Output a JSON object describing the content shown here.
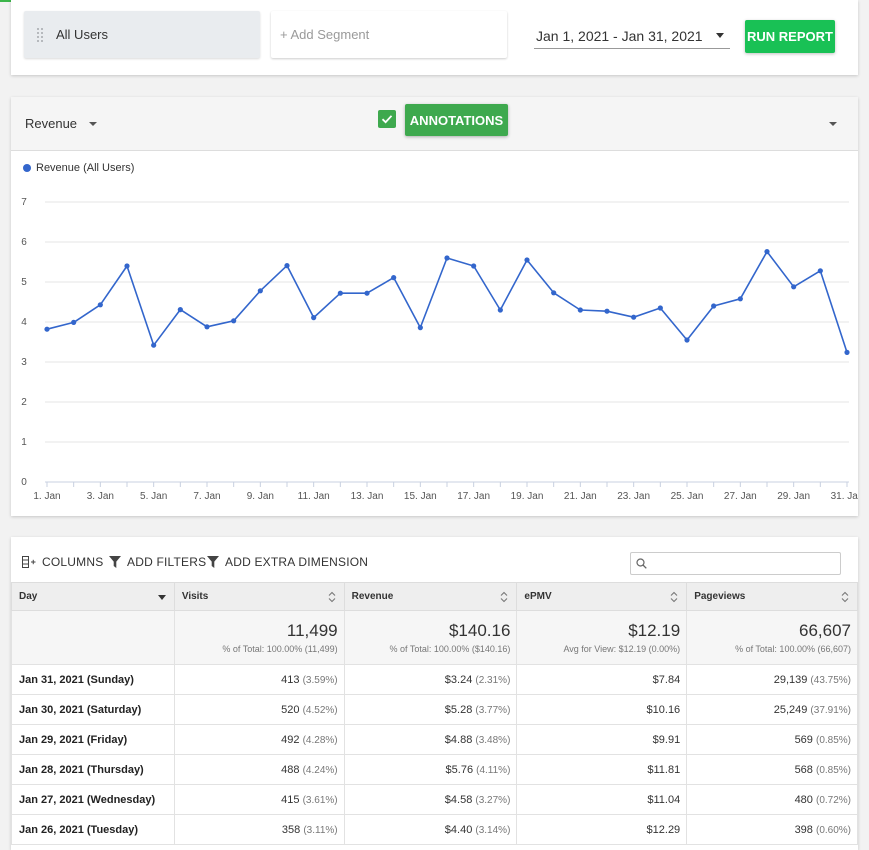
{
  "filters": {
    "segment_label": "All Users",
    "add_segment_label": "+ Add Segment",
    "date_range": "Jan 1, 2021 - Jan 31, 2021",
    "run_report_label": "RUN REPORT"
  },
  "chart_toolbar": {
    "metric": "Revenue",
    "annotations_label": "ANNOTATIONS"
  },
  "chart_data": {
    "type": "line",
    "x": [
      "1. Jan",
      "2. Jan",
      "3. Jan",
      "4. Jan",
      "5. Jan",
      "6. Jan",
      "7. Jan",
      "8. Jan",
      "9. Jan",
      "10. Jan",
      "11. Jan",
      "12. Jan",
      "13. Jan",
      "14. Jan",
      "15. Jan",
      "16. Jan",
      "17. Jan",
      "18. Jan",
      "19. Jan",
      "20. Jan",
      "21. Jan",
      "22. Jan",
      "23. Jan",
      "24. Jan",
      "25. Jan",
      "26. Jan",
      "27. Jan",
      "28. Jan",
      "29. Jan",
      "30. Jan",
      "31. Jan"
    ],
    "tick_labels": [
      "1. Jan",
      "3. Jan",
      "5. Jan",
      "7. Jan",
      "9. Jan",
      "11. Jan",
      "13. Jan",
      "15. Jan",
      "17. Jan",
      "19. Jan",
      "21. Jan",
      "23. Jan",
      "25. Jan",
      "27. Jan",
      "29. Jan",
      "31. Jan"
    ],
    "series": [
      {
        "name": "Revenue (All Users)",
        "color": "#3366cc",
        "values": [
          3.82,
          3.99,
          4.43,
          5.4,
          3.42,
          4.31,
          3.88,
          4.03,
          4.78,
          5.41,
          4.11,
          4.72,
          4.72,
          5.11,
          3.86,
          5.6,
          5.4,
          4.3,
          5.55,
          4.73,
          4.3,
          4.27,
          4.12,
          4.35,
          3.55,
          4.4,
          4.58,
          5.76,
          4.88,
          5.28,
          3.24
        ]
      }
    ],
    "ylim": [
      0,
      7
    ],
    "yticks": [
      0,
      1,
      2,
      3,
      4,
      5,
      6,
      7
    ],
    "grid": true
  },
  "table_tools": {
    "columns_label": "COLUMNS",
    "filters_label": "ADD FILTERS",
    "dimension_label": "ADD EXTRA DIMENSION",
    "search_placeholder": ""
  },
  "table": {
    "headers": [
      "Day",
      "Visits",
      "Revenue",
      "ePMV",
      "Pageviews"
    ],
    "totals": [
      {
        "value": "11,499",
        "sub": "% of Total: 100.00% (11,499)"
      },
      {
        "value": "$140.16",
        "sub": "% of Total: 100.00% ($140.16)"
      },
      {
        "value": "$12.19",
        "sub": "Avg for View: $12.19 (0.00%)"
      },
      {
        "value": "66,607",
        "sub": "% of Total: 100.00% (66,607)"
      }
    ],
    "rows": [
      {
        "day": "Jan 31, 2021 (Sunday)",
        "visits": "413",
        "visits_pct": "(3.59%)",
        "revenue": "$3.24",
        "revenue_pct": "(2.31%)",
        "epmv": "$7.84",
        "pageviews": "29,139",
        "pageviews_pct": "(43.75%)"
      },
      {
        "day": "Jan 30, 2021 (Saturday)",
        "visits": "520",
        "visits_pct": "(4.52%)",
        "revenue": "$5.28",
        "revenue_pct": "(3.77%)",
        "epmv": "$10.16",
        "pageviews": "25,249",
        "pageviews_pct": "(37.91%)"
      },
      {
        "day": "Jan 29, 2021 (Friday)",
        "visits": "492",
        "visits_pct": "(4.28%)",
        "revenue": "$4.88",
        "revenue_pct": "(3.48%)",
        "epmv": "$9.91",
        "pageviews": "569",
        "pageviews_pct": "(0.85%)"
      },
      {
        "day": "Jan 28, 2021 (Thursday)",
        "visits": "488",
        "visits_pct": "(4.24%)",
        "revenue": "$5.76",
        "revenue_pct": "(4.11%)",
        "epmv": "$11.81",
        "pageviews": "568",
        "pageviews_pct": "(0.85%)"
      },
      {
        "day": "Jan 27, 2021 (Wednesday)",
        "visits": "415",
        "visits_pct": "(3.61%)",
        "revenue": "$4.58",
        "revenue_pct": "(3.27%)",
        "epmv": "$11.04",
        "pageviews": "480",
        "pageviews_pct": "(0.72%)"
      },
      {
        "day": "Jan 26, 2021 (Tuesday)",
        "visits": "358",
        "visits_pct": "(3.11%)",
        "revenue": "$4.40",
        "revenue_pct": "(3.14%)",
        "epmv": "$12.29",
        "pageviews": "398",
        "pageviews_pct": "(0.60%)"
      }
    ]
  }
}
